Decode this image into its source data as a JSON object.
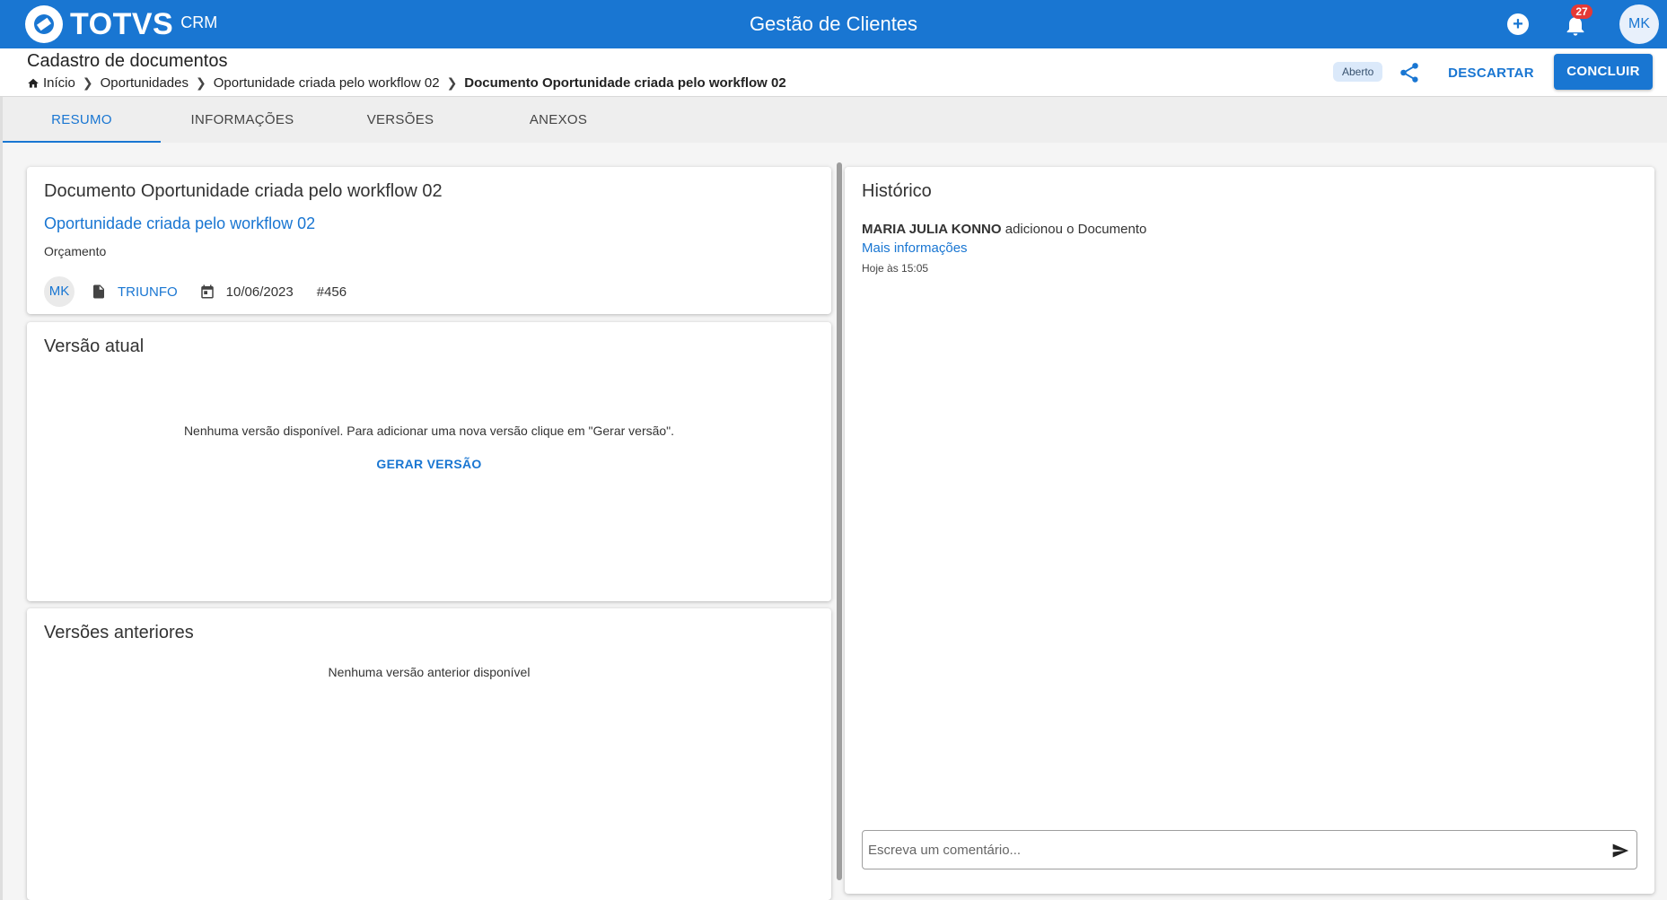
{
  "topbar": {
    "logo_text": "TOTVS",
    "logo_sub": "CRM",
    "app_title": "Gestão de Clientes",
    "notifications_count": "27",
    "user_initials": "MK",
    "accent_color": "#1976d2",
    "icons": [
      "totvs-logo-icon",
      "add-circle-icon",
      "bell-icon"
    ]
  },
  "header": {
    "title": "Cadastro de documentos",
    "breadcrumb": [
      "Início",
      "Oportunidades",
      "Oportunidade criada pelo workflow 02",
      "Documento Oportunidade criada pelo workflow 02"
    ],
    "status": "Aberto",
    "discard_label": "DESCARTAR",
    "conclude_label": "CONCLUIR"
  },
  "tabs": [
    {
      "label": "RESUMO",
      "active": true
    },
    {
      "label": "INFORMAÇÕES",
      "active": false
    },
    {
      "label": "VERSÕES",
      "active": false
    },
    {
      "label": "ANEXOS",
      "active": false
    }
  ],
  "document": {
    "title": "Documento Oportunidade criada pelo workflow 02",
    "opportunity_link": "Oportunidade criada pelo workflow 02",
    "type": "Orçamento",
    "owner_initials": "MK",
    "company": "TRIUNFO",
    "date": "10/06/2023",
    "id": "#456"
  },
  "current_version": {
    "title": "Versão atual",
    "empty_message": "Nenhuma versão disponível. Para adicionar uma nova versão clique em \"Gerar versão\".",
    "generate_label": "GERAR VERSÃO"
  },
  "previous_versions": {
    "title": "Versões anteriores",
    "empty_message": "Nenhuma versão anterior disponível"
  },
  "history": {
    "title": "Histórico",
    "entries": [
      {
        "user": "MARIA JULIA KONNO",
        "action": " adicionou o Documento",
        "link": "Mais informações",
        "time": "Hoje às 15:05"
      }
    ],
    "comment_placeholder": "Escreva um comentário..."
  }
}
